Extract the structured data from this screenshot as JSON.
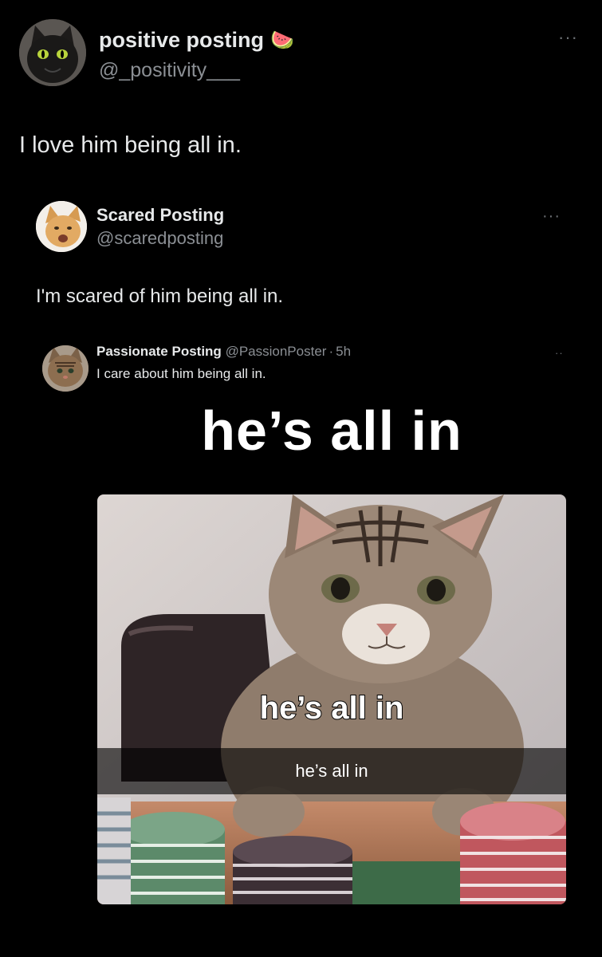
{
  "main_post": {
    "display_name": "positive posting",
    "badge_emoji": "🍉",
    "handle": "@_positivity___",
    "text": "I love him being all in.",
    "more_icon": "ellipsis-icon"
  },
  "quoted_post": {
    "display_name": "Scared Posting",
    "handle": "@scaredposting",
    "text": "I'm scared of him being all in.",
    "more_icon": "ellipsis-icon"
  },
  "nested_quote": {
    "display_name": "Passionate Posting",
    "handle": "@PassionPoster",
    "separator": "·",
    "time": "5h",
    "text": "I care about him being all in.",
    "more_icon": "ellipsis-icon"
  },
  "meme": {
    "top_caption": "he’s all in",
    "middle_caption": "he’s all in",
    "bar_caption": "he’s all in"
  }
}
